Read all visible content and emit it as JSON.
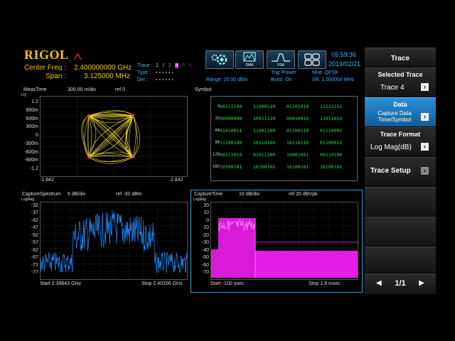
{
  "header": {
    "brand": "RIGOL",
    "center_freq_label": "Center Freq :",
    "center_freq_value": "2.400000000 GHz",
    "span_label": "Span :",
    "span_value": "3.125000 MHz",
    "trace_label": "Trace :",
    "trace_numbers": [
      "1",
      "2",
      "3",
      "4",
      "5",
      "6"
    ],
    "type_label": "Type :",
    "det_label": "Det :",
    "range": "Range: 20.00 dBm",
    "trig": "Trig: Power",
    "burst": "Burst: On",
    "mod": "Mod: QPSK",
    "sr": "SR: 1.000000 MHz",
    "time": "05:59:36",
    "date": "2019/02/21",
    "toolbar_buttons": [
      "DMA",
      "VSA"
    ]
  },
  "panes": {
    "constellation": {
      "title": "MeasTime",
      "scale": "300.00 m/div",
      "ref": "ref 0",
      "unit": "I-Q",
      "yticks": [
        "1.2",
        "900m",
        "600m",
        "300m",
        "0",
        "-300m",
        "-600m",
        "-900m",
        "-1.2"
      ],
      "xleft": "-2.842",
      "xright": "2.842"
    },
    "symbol": {
      "title": "Symbol",
      "rows": [
        {
          "index": "0",
          "bits": [
            "00111100",
            "11000110",
            "01101010",
            "11111111"
          ]
        },
        {
          "index": "32",
          "bits": [
            "00000000",
            "10011110",
            "00010010",
            "11011010"
          ]
        },
        {
          "index": "64",
          "bits": [
            "01010011",
            "11001100",
            "01100110",
            "01110001"
          ]
        },
        {
          "index": "96",
          "bits": [
            "11100100",
            "10110100",
            "10110110",
            "01100011"
          ]
        },
        {
          "index": "128",
          "bits": [
            "00111010",
            "01011100",
            "10001001",
            "00110100"
          ]
        },
        {
          "index": "160",
          "bits": [
            "10100101",
            "10100101",
            "10100101",
            "10100101"
          ]
        }
      ]
    },
    "spectrum": {
      "title": "CaptureSpectrum",
      "scale": "5 dB/div",
      "ref": "ref -32 dBm",
      "unit": "LogMag",
      "yticks": [
        "-32",
        "-37",
        "-42",
        "-47",
        "-52",
        "-57",
        "-62",
        "-67",
        "-72",
        "-77"
      ],
      "start": "Start 2.39843 GHz",
      "stop": "Stop 2.40156 GHz"
    },
    "capture_time": {
      "title": "CaptureTime",
      "scale": "10 dB/div",
      "ref": "ref 20 dBVpk",
      "unit": "LogMag",
      "yticks": [
        "20",
        "10",
        "0",
        "-10",
        "-20",
        "-30",
        "-40",
        "-50",
        "-60",
        "-70"
      ],
      "start": "Start -100 usec",
      "stop": "Stop 1.9 msec"
    }
  },
  "menu": {
    "title": "Trace",
    "selected_trace_label": "Selected Trace",
    "selected_trace_value": "Trace 4",
    "data_label": "Data",
    "data_value_line1": "Capture Data",
    "data_value_line2": "Time/Symbol",
    "trace_format_label": "Trace Format",
    "trace_format_value": "Log Mag(dB)",
    "trace_setup_label": "Trace Setup",
    "page": "1/1"
  },
  "colors": {
    "brand": "#f5c400",
    "freq_text": "#f5c400",
    "constellation_trace": "#f0e030",
    "spectrum_trace": "#1e8cff",
    "time_trace": "#ff20ff",
    "symbol_bits": "#23e04a",
    "highlight_border": "#2aa6d8",
    "menu_selected": "#1d80c8"
  }
}
